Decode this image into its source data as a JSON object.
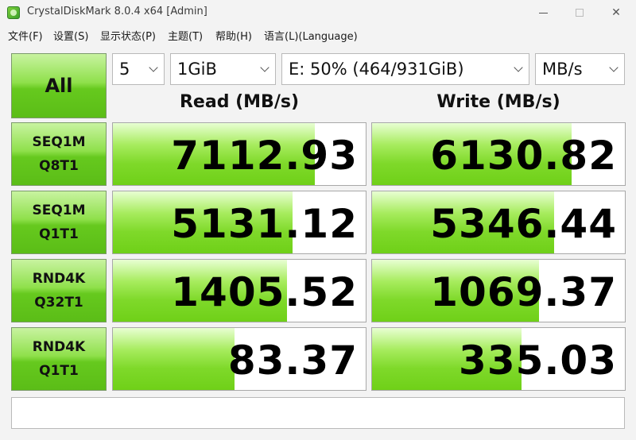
{
  "window": {
    "title": "CrystalDiskMark 8.0.4 x64 [Admin]"
  },
  "menu": {
    "file": "文件(F)",
    "settings": "设置(S)",
    "display": "显示状态(P)",
    "theme": "主题(T)",
    "help": "帮助(H)",
    "language": "语言(L)(Language)"
  },
  "controls": {
    "all_label": "All",
    "count": "5",
    "size": "1GiB",
    "drive": "E: 50% (464/931GiB)",
    "unit": "MB/s"
  },
  "headers": {
    "read": "Read (MB/s)",
    "write": "Write (MB/s)"
  },
  "tests": [
    {
      "line1": "SEQ1M",
      "line2": "Q8T1",
      "read": "7112.93",
      "write": "6130.82",
      "read_fill_pct": 80,
      "write_fill_pct": 79
    },
    {
      "line1": "SEQ1M",
      "line2": "Q1T1",
      "read": "5131.12",
      "write": "5346.44",
      "read_fill_pct": 71,
      "write_fill_pct": 72
    },
    {
      "line1": "RND4K",
      "line2": "Q32T1",
      "read": "1405.52",
      "write": "1069.37",
      "read_fill_pct": 69,
      "write_fill_pct": 66
    },
    {
      "line1": "RND4K",
      "line2": "Q1T1",
      "read": "83.37",
      "write": "335.03",
      "read_fill_pct": 48,
      "write_fill_pct": 59
    }
  ],
  "comment": ""
}
